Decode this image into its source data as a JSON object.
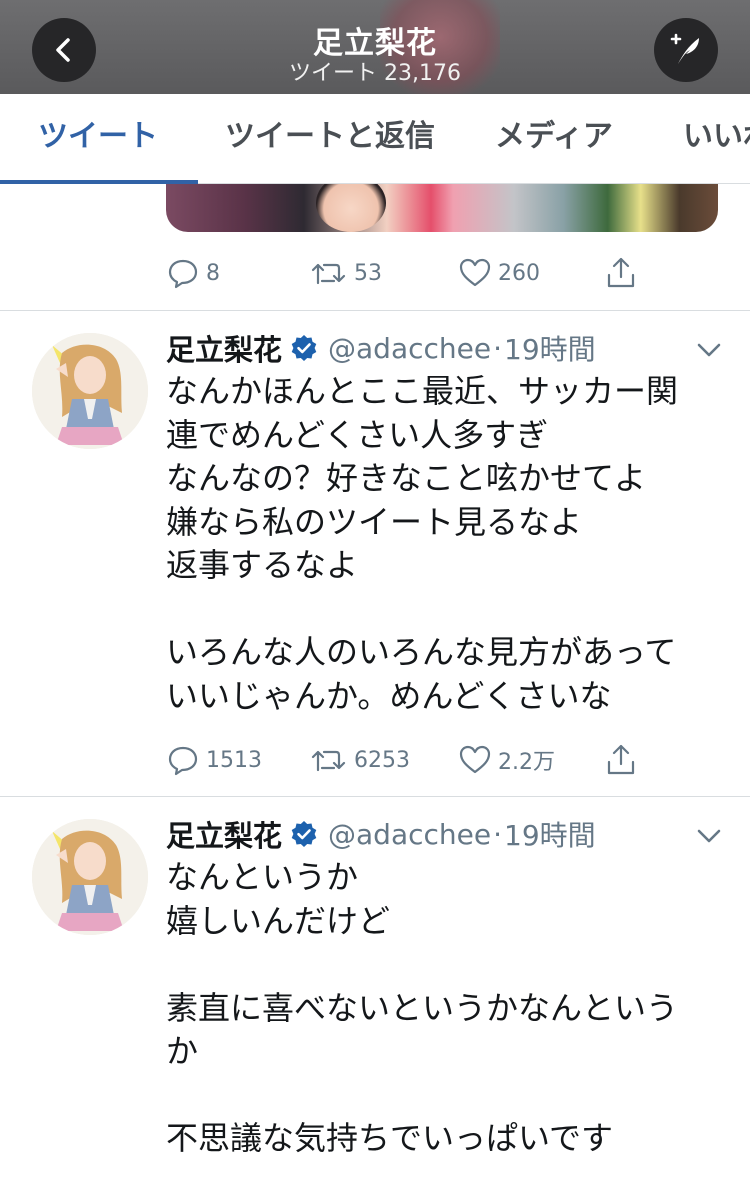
{
  "header": {
    "title": "足立梨花",
    "subtitle": "ツイート 23,176"
  },
  "tabs": [
    {
      "label": "ツイート",
      "active": true
    },
    {
      "label": "ツイートと返信",
      "active": false
    },
    {
      "label": "メディア",
      "active": false
    },
    {
      "label": "いいね",
      "active": false
    }
  ],
  "colors": {
    "accent": "#3162a6",
    "verified": "#1d61ad",
    "muted": "#657786"
  },
  "prev_tweet": {
    "replies": "8",
    "retweets": "53",
    "likes": "260"
  },
  "tweets": [
    {
      "name": "足立梨花",
      "handle": "@adacchee",
      "dot": "·",
      "time": "19時間",
      "verified": true,
      "body": "なんかほんとここ最近、サッカー関\n連でめんどくさい人多すぎ\nなんなの？好きなこと呟かせてよ\n嫌なら私のツイート見るなよ\n返事するなよ\n\nいろんな人のいろんな見方があって\nいいじゃんか。めんどくさいな",
      "replies": "1513",
      "retweets": "6253",
      "likes": "2.2万"
    },
    {
      "name": "足立梨花",
      "handle": "@adacchee",
      "dot": "·",
      "time": "19時間",
      "verified": true,
      "body": "なんというか\n嬉しいんだけど\n\n素直に喜べないというかなんという\nか\n\n不思議な気持ちでいっぱいです"
    }
  ]
}
